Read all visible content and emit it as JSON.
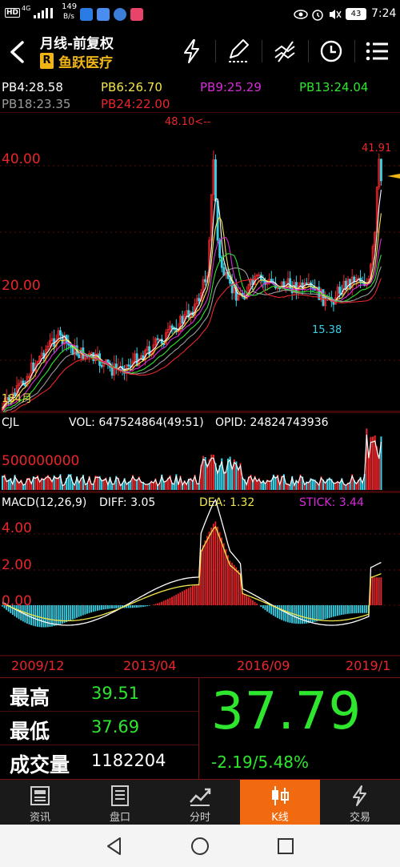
{
  "status": {
    "network_badge": "HD",
    "network_type": "4G",
    "speed": "149",
    "speed_unit": "B/s",
    "battery": "43",
    "time": "7:24"
  },
  "header": {
    "title": "月线-前复权",
    "badge": "R",
    "stock_name": "鱼跃医疗"
  },
  "indicators": {
    "pb4": "PB4:28.58",
    "pb6": "PB6:26.70",
    "pb9": "PB9:25.29",
    "pb13": "PB13:24.04",
    "pb18": "PB18:23.35",
    "pb24": "PB24:22.00"
  },
  "main_chart": {
    "y40": "40.00",
    "y20": "20.00",
    "high_note": "48.10<--",
    "recent_high": "41.91",
    "low_note": "15.38",
    "count_note": "184月"
  },
  "volume": {
    "name": "CJL",
    "vol": "VOL: 647524864(49:51)",
    "opid": "OPID: 24824743936",
    "axis": "500000000"
  },
  "macd": {
    "name": "MACD(12,26,9)",
    "diff": "DIFF: 3.05",
    "dea": "DEA: 1.32",
    "stick": "STICK: 3.44",
    "y4": "4.00",
    "y2": "2.00",
    "y0": "0.00"
  },
  "dates": [
    "2009/12",
    "2013/04",
    "2016/09",
    "2019/1"
  ],
  "price": {
    "high_label": "最高",
    "high_value": "39.51",
    "low_label": "最低",
    "low_value": "37.69",
    "volume_label": "成交量",
    "volume_value": "1182204",
    "last": "37.79",
    "change": "-2.19/5.48%"
  },
  "tabs": [
    "资讯",
    "盘口",
    "分时",
    "K线",
    "交易"
  ],
  "colors": {
    "up": "#e8262b",
    "down": "#39d0e6",
    "green": "#2ee62e",
    "yellow": "#f2e64a",
    "magenta": "#d92ad9",
    "active_tab": "#f26a10"
  }
}
